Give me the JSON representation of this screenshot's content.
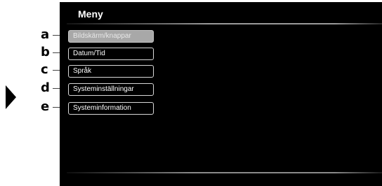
{
  "callouts": [
    "a",
    "b",
    "c",
    "d",
    "e"
  ],
  "menu": {
    "title": "Meny",
    "items": [
      {
        "label": "Bildskärm/knappar",
        "selected": true
      },
      {
        "label": "Datum/Tid",
        "selected": false
      },
      {
        "label": "Språk",
        "selected": false
      },
      {
        "label": "Systeminställningar",
        "selected": false
      },
      {
        "label": "Systeminformation",
        "selected": false
      }
    ]
  },
  "colors": {
    "screen_background": "#000000",
    "selected_item": "#a8a8a8",
    "item_border": "#d8d8d8"
  }
}
